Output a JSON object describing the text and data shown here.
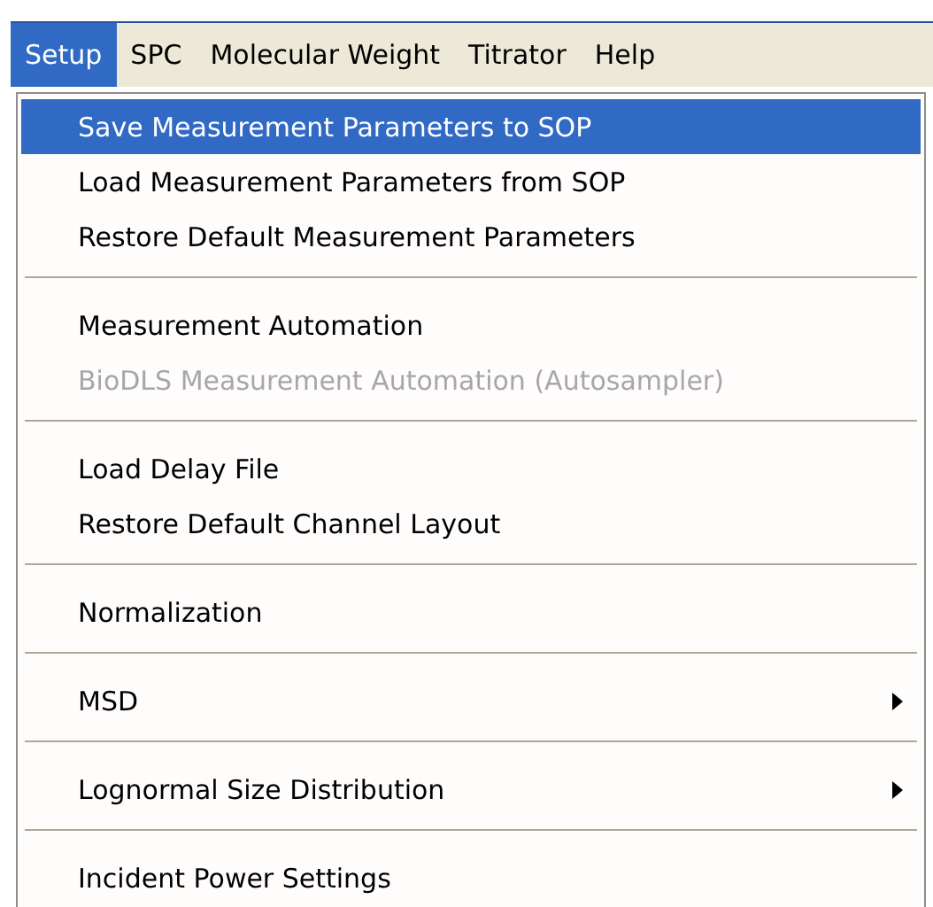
{
  "menu_bar": [
    {
      "label": "Setup",
      "selected": true
    },
    {
      "label": "SPC",
      "selected": false
    },
    {
      "label": "Molecular Weight",
      "selected": false
    },
    {
      "label": "Titrator",
      "selected": false
    },
    {
      "label": "Help",
      "selected": false
    }
  ],
  "dropdown": [
    {
      "kind": "item",
      "label": "Save Measurement Parameters to SOP",
      "selected": true,
      "disabled": false,
      "submenu": false
    },
    {
      "kind": "item",
      "label": "Load Measurement Parameters from SOP",
      "selected": false,
      "disabled": false,
      "submenu": false
    },
    {
      "kind": "item",
      "label": "Restore Default Measurement Parameters",
      "selected": false,
      "disabled": false,
      "submenu": false
    },
    {
      "kind": "separator"
    },
    {
      "kind": "item",
      "label": "Measurement Automation",
      "selected": false,
      "disabled": false,
      "submenu": false
    },
    {
      "kind": "item",
      "label": "BioDLS Measurement Automation (Autosampler)",
      "selected": false,
      "disabled": true,
      "submenu": false
    },
    {
      "kind": "separator"
    },
    {
      "kind": "item",
      "label": "Load Delay File",
      "selected": false,
      "disabled": false,
      "submenu": false
    },
    {
      "kind": "item",
      "label": "Restore Default Channel Layout",
      "selected": false,
      "disabled": false,
      "submenu": false
    },
    {
      "kind": "separator"
    },
    {
      "kind": "item",
      "label": "Normalization",
      "selected": false,
      "disabled": false,
      "submenu": false
    },
    {
      "kind": "separator"
    },
    {
      "kind": "item",
      "label": "MSD",
      "selected": false,
      "disabled": false,
      "submenu": true
    },
    {
      "kind": "separator"
    },
    {
      "kind": "item",
      "label": "Lognormal Size Distribution",
      "selected": false,
      "disabled": false,
      "submenu": true
    },
    {
      "kind": "separator"
    },
    {
      "kind": "item",
      "label": "Incident Power Settings",
      "selected": false,
      "disabled": false,
      "submenu": false
    }
  ]
}
